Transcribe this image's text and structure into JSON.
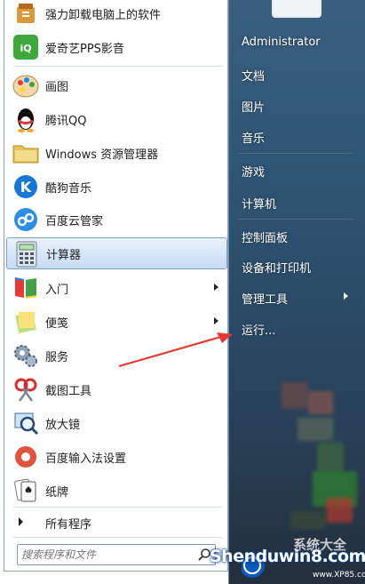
{
  "programs": [
    {
      "label": "强力卸载电脑上的软件",
      "icon": "uninstall-icon",
      "submenu": false
    },
    {
      "label": "爱奇艺PPS影音",
      "icon": "iqiyi-icon",
      "submenu": false
    },
    {
      "label": "画图",
      "icon": "paint-icon",
      "submenu": false
    },
    {
      "label": "腾讯QQ",
      "icon": "qq-penguin-icon",
      "submenu": false
    },
    {
      "label": "Windows 资源管理器",
      "icon": "explorer-folder-icon",
      "submenu": false
    },
    {
      "label": "酷狗音乐",
      "icon": "kugou-icon",
      "submenu": false
    },
    {
      "label": "百度云管家",
      "icon": "baidu-cloud-icon",
      "submenu": false
    },
    {
      "label": "计算器",
      "icon": "calculator-icon",
      "submenu": false,
      "selected": true
    },
    {
      "label": "入门",
      "icon": "getting-started-icon",
      "submenu": true
    },
    {
      "label": "便笺",
      "icon": "sticky-notes-icon",
      "submenu": true
    },
    {
      "label": "服务",
      "icon": "services-gear-icon",
      "submenu": false
    },
    {
      "label": "截图工具",
      "icon": "snipping-tool-icon",
      "submenu": false
    },
    {
      "label": "放大镜",
      "icon": "magnifier-icon",
      "submenu": false
    },
    {
      "label": "百度输入法设置",
      "icon": "ime-settings-icon",
      "submenu": false
    },
    {
      "label": "纸牌",
      "icon": "solitaire-icon",
      "submenu": false
    }
  ],
  "all_programs": "所有程序",
  "search": {
    "placeholder": "搜索程序和文件"
  },
  "right_menu": {
    "user": "Administrator",
    "items": [
      "文档",
      "图片",
      "音乐",
      "游戏",
      "计算机",
      "控制面板",
      "设备和打印机",
      "管理工具",
      "运行..."
    ]
  },
  "colors": {
    "accent_selected": "#c8dcf4",
    "pane_blue": "#2f5574",
    "annotation_red": "#e53935"
  },
  "watermark": {
    "brand": "Shenduwin8.com",
    "cn": "系统大全",
    "url": "www.XP85.com"
  }
}
